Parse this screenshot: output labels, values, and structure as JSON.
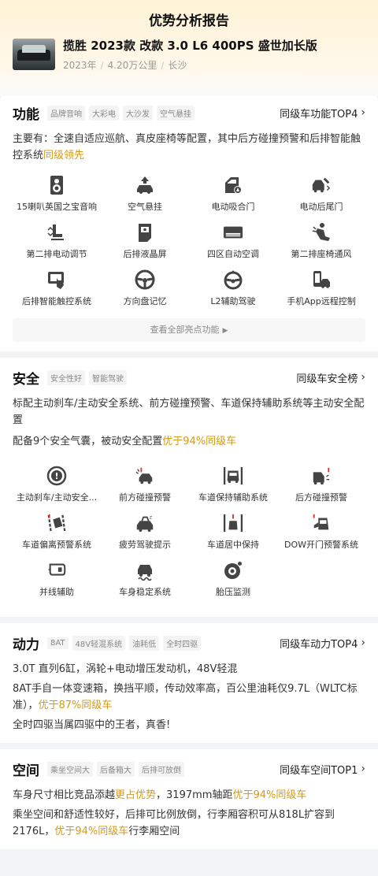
{
  "page_title": "优势分析报告",
  "car": {
    "name": "揽胜 2023款 改款 3.0 L6 400PS 盛世加长版",
    "year": "2023年",
    "mileage": "4.20万公里",
    "city": "长沙"
  },
  "function": {
    "title": "功能",
    "tags": [
      "品牌音响",
      "大彩电",
      "大沙发",
      "空气悬挂"
    ],
    "rank": "同级车功能TOP4",
    "desc_main": "主要有：全速自适应巡航、真皮座椅等配置，其中后方碰撞预警和后排智能触控系统",
    "desc_hl": "同级领先",
    "features": [
      {
        "label": "15喇叭英国之宝音响",
        "icon": "speaker-icon"
      },
      {
        "label": "空气悬挂",
        "icon": "air-suspension-icon"
      },
      {
        "label": "电动吸合门",
        "icon": "soft-close-door-icon"
      },
      {
        "label": "电动后尾门",
        "icon": "power-tailgate-icon"
      },
      {
        "label": "第二排电动调节",
        "icon": "power-seat-icon"
      },
      {
        "label": "后排液晶屏",
        "icon": "rear-screen-icon"
      },
      {
        "label": "四区自动空调",
        "icon": "climate-control-icon"
      },
      {
        "label": "第二排座椅通风",
        "icon": "seat-ventilation-icon"
      },
      {
        "label": "后排智能触控系统",
        "icon": "touch-control-icon"
      },
      {
        "label": "方向盘记忆",
        "icon": "steering-wheel-icon"
      },
      {
        "label": "L2辅助驾驶",
        "icon": "assisted-driving-icon"
      },
      {
        "label": "手机App远程控制",
        "icon": "remote-app-icon"
      }
    ],
    "more": "查看全部亮点功能"
  },
  "safety": {
    "title": "安全",
    "tags": [
      "安全性好",
      "智能驾驶"
    ],
    "rank": "同级车安全榜",
    "desc1": "标配主动刹车/主动安全系统、前方碰撞预警、车道保持辅助系统等主动安全配置",
    "desc2_main": "配备9个安全气囊，被动安全配置",
    "desc2_hl": "优于94%同级车",
    "features": [
      {
        "label": "主动刹车/主动安全...",
        "icon": "active-brake-icon"
      },
      {
        "label": "前方碰撞预警",
        "icon": "forward-collision-icon"
      },
      {
        "label": "车道保持辅助系统",
        "icon": "lane-keep-icon"
      },
      {
        "label": "后方碰撞预警",
        "icon": "rear-collision-icon"
      },
      {
        "label": "车道偏离预警系统",
        "icon": "lane-departure-icon"
      },
      {
        "label": "疲劳驾驶提示",
        "icon": "fatigue-icon"
      },
      {
        "label": "车道居中保持",
        "icon": "lane-center-icon"
      },
      {
        "label": "DOW开门预警系统",
        "icon": "door-open-warning-icon"
      },
      {
        "label": "并线辅助",
        "icon": "blind-spot-icon"
      },
      {
        "label": "车身稳定系统",
        "icon": "stability-icon"
      },
      {
        "label": "胎压监测",
        "icon": "tire-pressure-icon"
      }
    ]
  },
  "power": {
    "title": "动力",
    "tags": [
      "8AT",
      "48V轻混系统",
      "油耗低",
      "全时四驱"
    ],
    "rank": "同级车动力TOP4",
    "p1": "3.0T 直列6缸，涡轮+电动增压发动机，48V轻混",
    "p2_main": "8AT手自一体变速箱，换挡平顺，传动效率高，百公里油耗仅9.7L（WLTC标准），",
    "p2_hl": "优于87%同级车",
    "p3": "全时四驱当属四驱中的王者，真香!"
  },
  "space": {
    "title": "空间",
    "tags": [
      "乘坐空间大",
      "后备箱大",
      "后排可放倒"
    ],
    "rank": "同级车空间TOP1",
    "p1_a": "车身尺寸相比竞品添越",
    "p1_hl1": "更占优势",
    "p1_b": "，3197mm轴距",
    "p1_hl2": "优于94%同级车",
    "p2_a": "乘坐空间和舒适性较好，后排可比例放倒，行李厢容积可从818L扩容到2176L，",
    "p2_hl": "优于94%同级车",
    "p2_b": "行李厢空间"
  }
}
